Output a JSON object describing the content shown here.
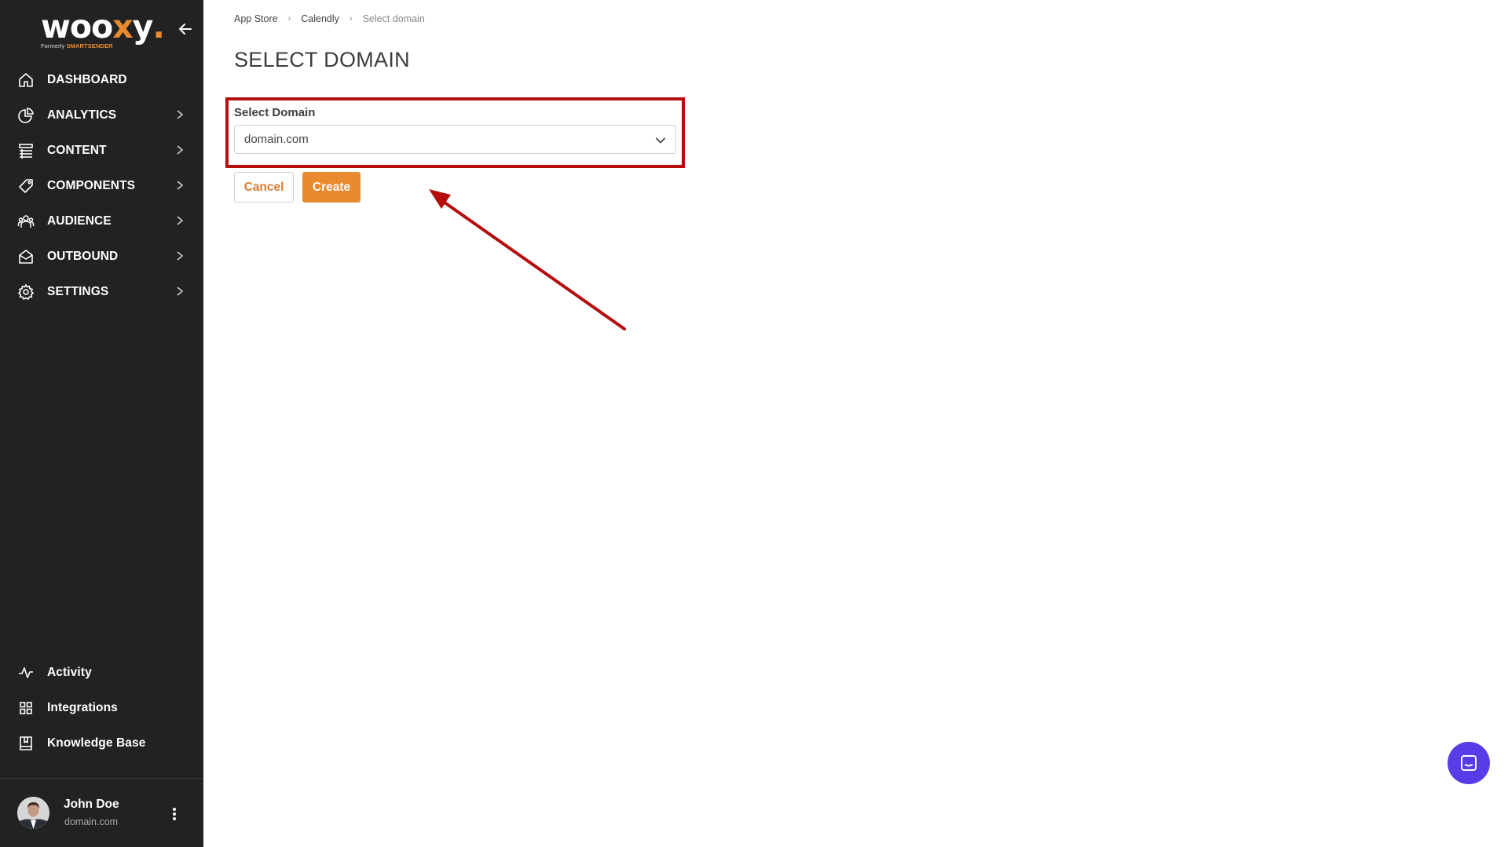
{
  "app": {
    "logo_main_before": "woo",
    "logo_x": "x",
    "logo_main_after": "y",
    "logo_dot": ".",
    "logo_formerly": "Formerly",
    "logo_brand_old": "SMARTSENDER",
    "brand_color": "#ea8a2f"
  },
  "sidebar": {
    "items": [
      {
        "label": "DASHBOARD",
        "icon": "home-icon",
        "has_chevron": false
      },
      {
        "label": "ANALYTICS",
        "icon": "chart-pie-icon",
        "has_chevron": true
      },
      {
        "label": "CONTENT",
        "icon": "list-icon",
        "has_chevron": true
      },
      {
        "label": "COMPONENTS",
        "icon": "tag-icon",
        "has_chevron": true
      },
      {
        "label": "AUDIENCE",
        "icon": "users-icon",
        "has_chevron": true
      },
      {
        "label": "OUTBOUND",
        "icon": "mail-open-icon",
        "has_chevron": true
      },
      {
        "label": "SETTINGS",
        "icon": "gear-icon",
        "has_chevron": true
      }
    ],
    "bottom_items": [
      {
        "label": "Activity",
        "icon": "activity-icon"
      },
      {
        "label": "Integrations",
        "icon": "grid-icon"
      },
      {
        "label": "Knowledge Base",
        "icon": "book-icon"
      }
    ],
    "user": {
      "name": "John Doe",
      "domain": "domain.com"
    }
  },
  "breadcrumb": {
    "items": [
      "App Store",
      "Calendly"
    ],
    "current": "Select domain"
  },
  "page": {
    "title": "SELECT DOMAIN",
    "field_label": "Select Domain",
    "selected_value": "domain.com",
    "cancel_label": "Cancel",
    "create_label": "Create"
  },
  "annotation": {
    "highlight_color": "#b50d0d"
  }
}
